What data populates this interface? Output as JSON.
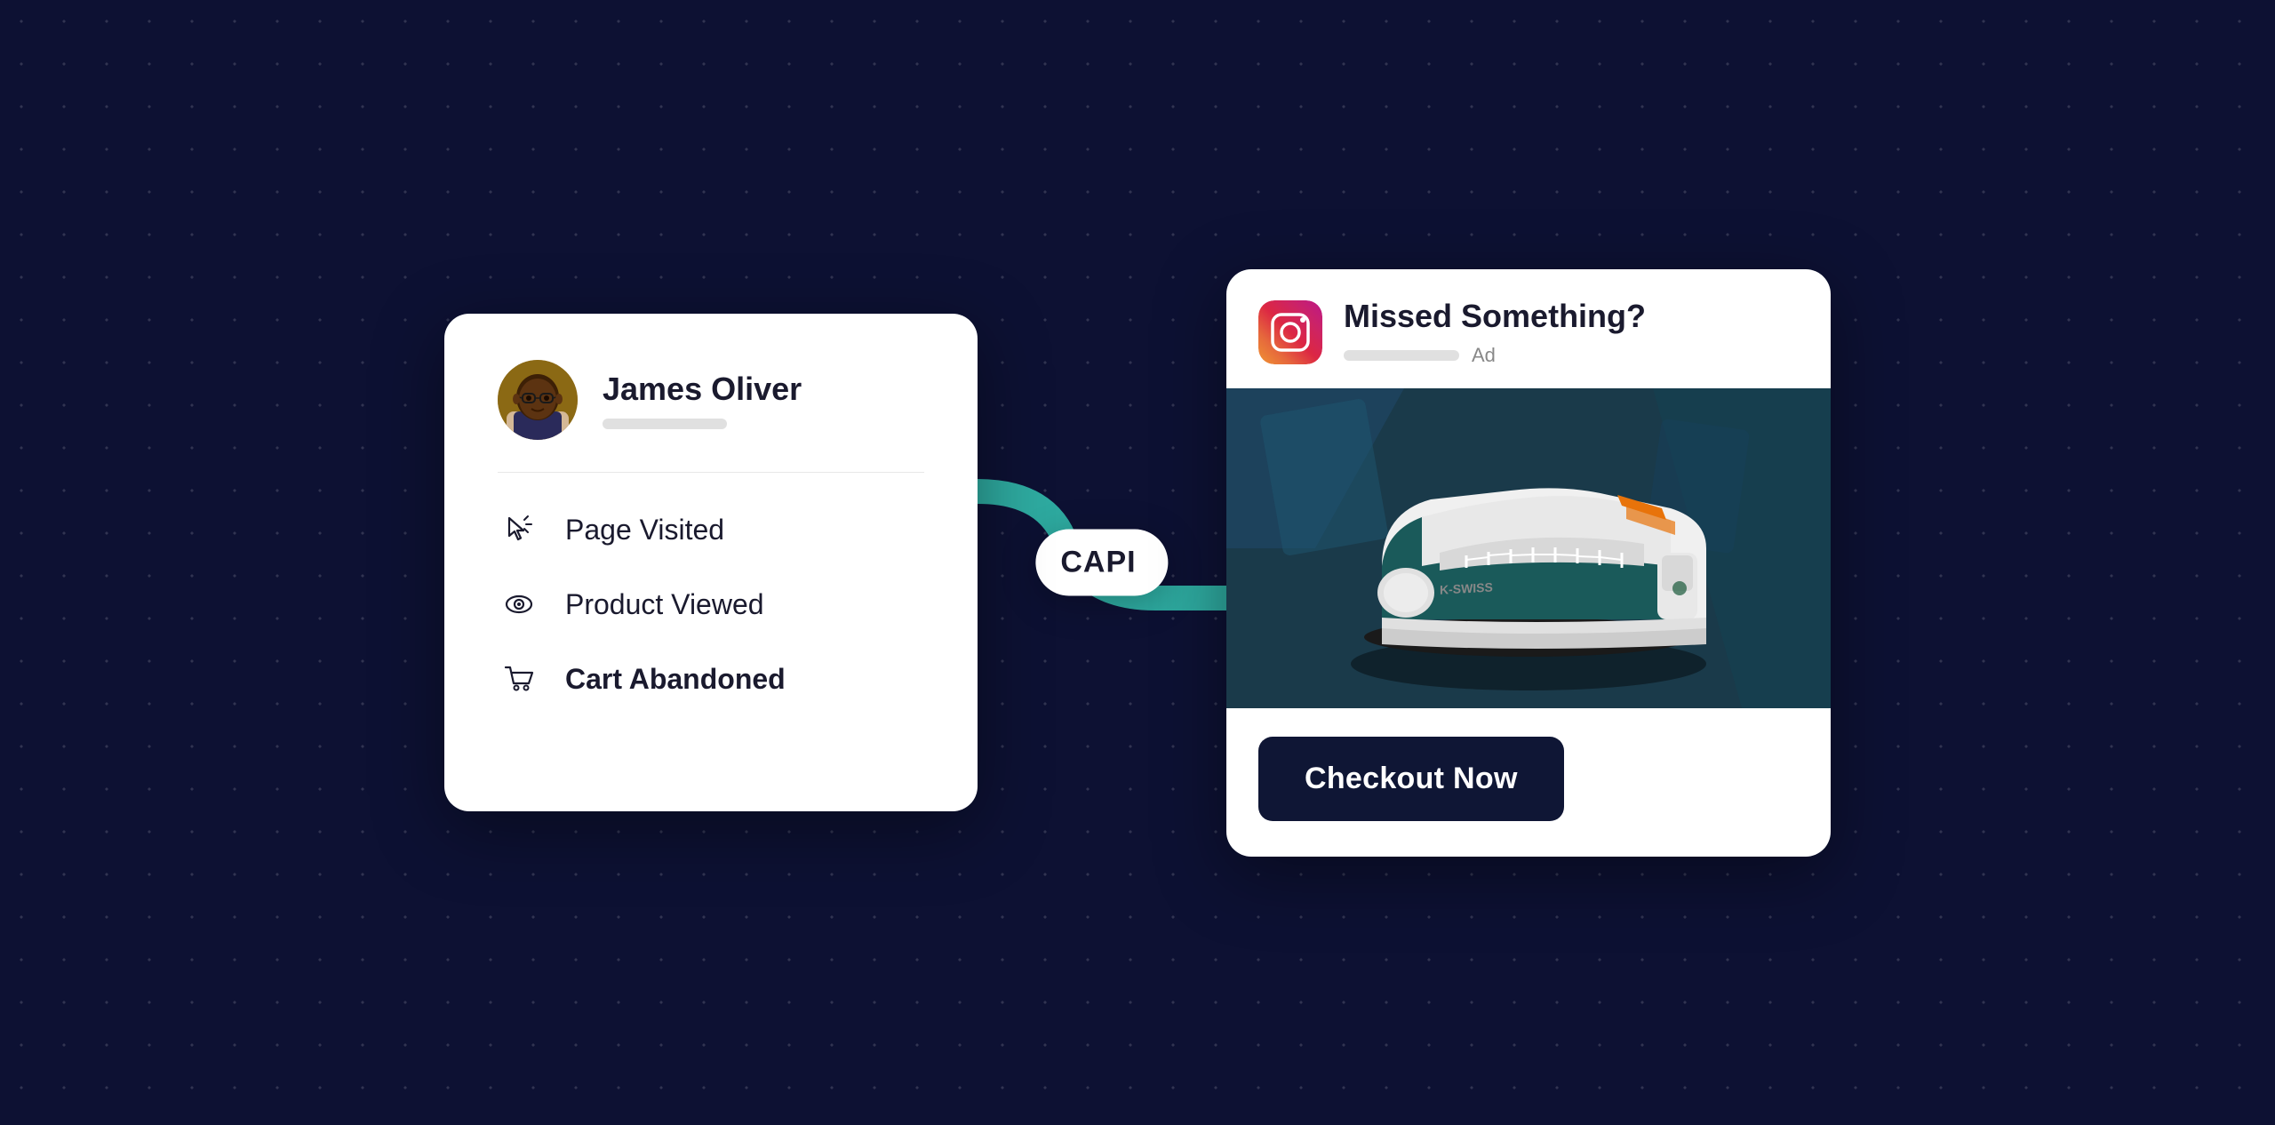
{
  "background": {
    "color": "#0d1133"
  },
  "user_card": {
    "user": {
      "name": "James Oliver",
      "subtitle_placeholder": "user subtitle bar"
    },
    "events": [
      {
        "id": "page-visited",
        "label": "Page Visited",
        "bold": false,
        "icon": "cursor-icon"
      },
      {
        "id": "product-viewed",
        "label": "Product Viewed",
        "bold": false,
        "icon": "eye-icon"
      },
      {
        "id": "cart-abandoned",
        "label": "Cart Abandoned",
        "bold": true,
        "icon": "cart-icon"
      }
    ]
  },
  "capi_badge": {
    "label": "CAPI",
    "icon": "meta-icon"
  },
  "instagram_ad": {
    "platform": "Instagram",
    "ad_label": "Ad",
    "title": "Missed Something?",
    "checkout_button_label": "Checkout Now"
  }
}
